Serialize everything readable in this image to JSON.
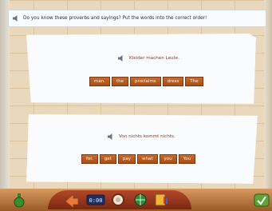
{
  "instruction": {
    "icon": "speaker-icon",
    "text": "Do you know these proverbs and sayings? Put the words into the correct order!"
  },
  "exercises": [
    {
      "sentence": "Kleider machen Leute.",
      "words": [
        "man.",
        "the",
        "proclaims",
        "dress",
        "The"
      ]
    },
    {
      "sentence": "Von nichts kommt nichts.",
      "words": [
        "for.",
        "get",
        "pay",
        "what",
        "you",
        "You"
      ]
    }
  ],
  "toolbar": {
    "clock_text": "0:00",
    "buttons": [
      "potion-icon",
      "home-arrow-icon",
      "clock-icon",
      "mirror-icon",
      "globe-icon",
      "dictionary-icon",
      "check-icon"
    ]
  },
  "colors": {
    "tile": "#b85a20",
    "sentence_text": "#8a3d1a",
    "toolbar": "#a44f18"
  }
}
